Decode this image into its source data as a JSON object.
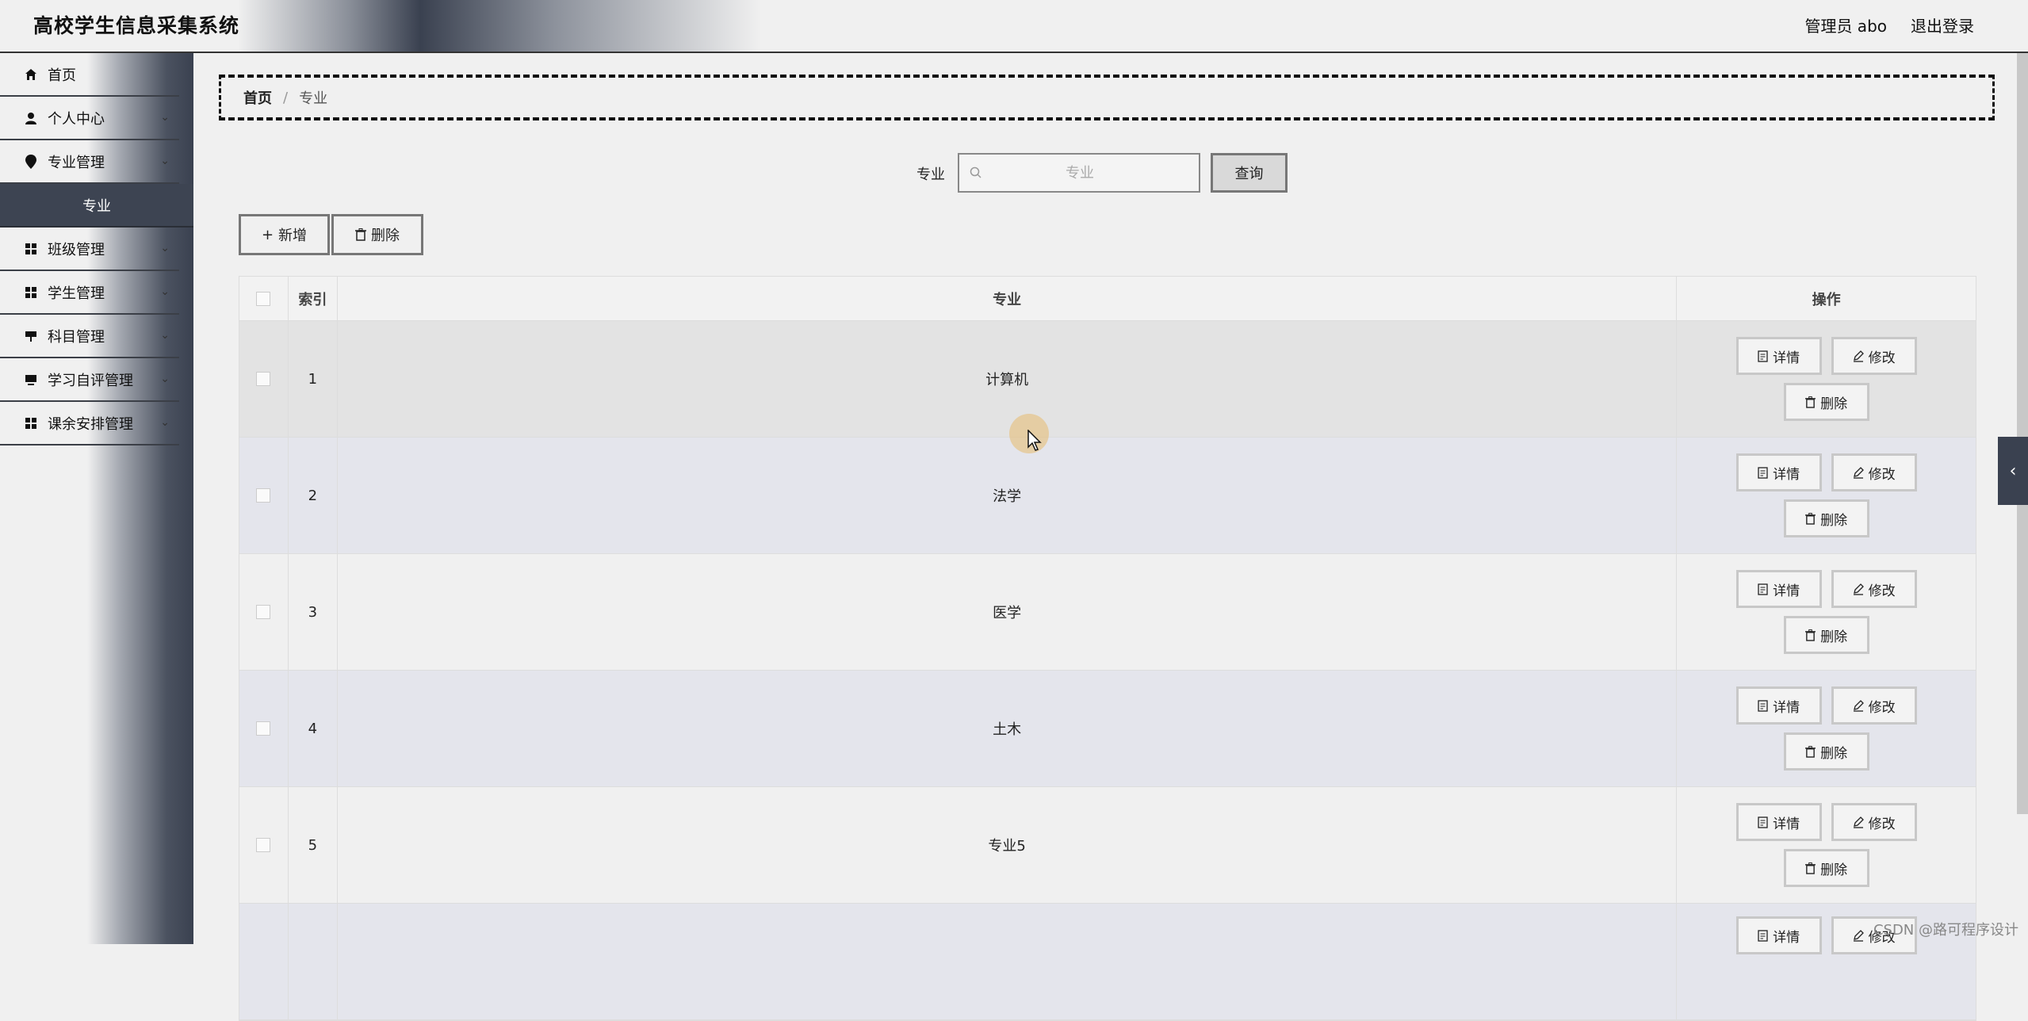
{
  "header": {
    "title": "高校学生信息采集系统",
    "user": "管理员 abo",
    "logout": "退出登录"
  },
  "sidebar": {
    "items": [
      {
        "label": "首页",
        "icon": "home-icon"
      },
      {
        "label": "个人中心",
        "icon": "user-icon",
        "expandable": true
      },
      {
        "label": "专业管理",
        "icon": "pin-icon",
        "expandable": true
      },
      {
        "label": "专业",
        "sub": true,
        "active": true
      },
      {
        "label": "班级管理",
        "icon": "grid-icon",
        "expandable": true
      },
      {
        "label": "学生管理",
        "icon": "grid-icon",
        "expandable": true
      },
      {
        "label": "科目管理",
        "icon": "board-icon",
        "expandable": true
      },
      {
        "label": "学习自评管理",
        "icon": "monitor-icon",
        "expandable": true
      },
      {
        "label": "课余安排管理",
        "icon": "grid-icon",
        "expandable": true
      }
    ]
  },
  "breadcrumb": {
    "home": "首页",
    "separator": "/",
    "current": "专业"
  },
  "search": {
    "label": "专业",
    "placeholder": "专业",
    "button": "查询"
  },
  "toolbar": {
    "add": "新增",
    "delete": "删除"
  },
  "table": {
    "headers": {
      "index": "索引",
      "major": "专业",
      "ops": "操作"
    },
    "rows": [
      {
        "index": "1",
        "major": "计算机"
      },
      {
        "index": "2",
        "major": "法学"
      },
      {
        "index": "3",
        "major": "医学"
      },
      {
        "index": "4",
        "major": "土木"
      },
      {
        "index": "5",
        "major": "专业5"
      }
    ],
    "ops": {
      "detail": "详情",
      "edit": "修改",
      "delete": "删除"
    }
  },
  "watermark": "CSDN @路可程序设计",
  "colors": {
    "sidebar_dark": "#3a4150",
    "accent_sub": "#3d4452"
  }
}
